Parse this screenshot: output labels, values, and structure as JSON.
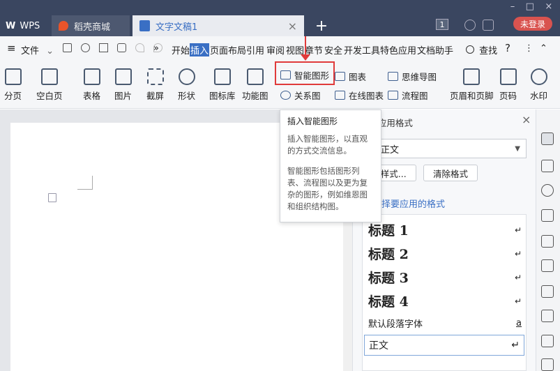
{
  "tabs": {
    "wps": "WPS",
    "mall": "稻壳商城",
    "doc": "文字文稿1",
    "add": "+",
    "close": "×",
    "badge": "1",
    "login": "未登录"
  },
  "menu": {
    "file": "文件",
    "items": [
      "开始",
      "插入",
      "页面布局",
      "引用",
      "审阅",
      "视图",
      "章节",
      "安全",
      "开发工具",
      "特色应用",
      "文档助手"
    ],
    "search": "查找",
    "more": "»"
  },
  "ribbon": {
    "big": [
      "分页",
      "空白页",
      "表格",
      "图片",
      "截屏",
      "形状",
      "图标库",
      "功能图"
    ],
    "smart_art": "智能图形",
    "chart": "图表",
    "mindmap": "思维导图",
    "relation": "关系图",
    "online_chart": "在线图表",
    "flowchart": "流程图",
    "header_footer": "页眉和页脚",
    "page_num": "页码",
    "watermark": "水印"
  },
  "tooltip": {
    "title": "插入智能图形",
    "desc1": "插入智能图形，以直观的方式交流信息。",
    "desc2": "智能图形包括图形列表、流程图以及更为复杂的图形，例如维恩图和组织结构图。"
  },
  "panel": {
    "header": "...应用格式",
    "current": "正文",
    "new_style": "新样式...",
    "clear": "清除格式",
    "choose": "请选择要应用的格式",
    "styles": [
      {
        "label": "标题 1",
        "mark": "↵"
      },
      {
        "label": "标题 2",
        "mark": "↵"
      },
      {
        "label": "标题 3",
        "mark": "↵"
      },
      {
        "label": "标题 4",
        "mark": "↵"
      },
      {
        "label": "默认段落字体",
        "mark": "a"
      },
      {
        "label": "正文",
        "mark": "↵"
      }
    ]
  },
  "colors": {
    "accent": "#3a6fc4",
    "highlight": "#e03a3a",
    "titlebar": "#3a4660"
  }
}
